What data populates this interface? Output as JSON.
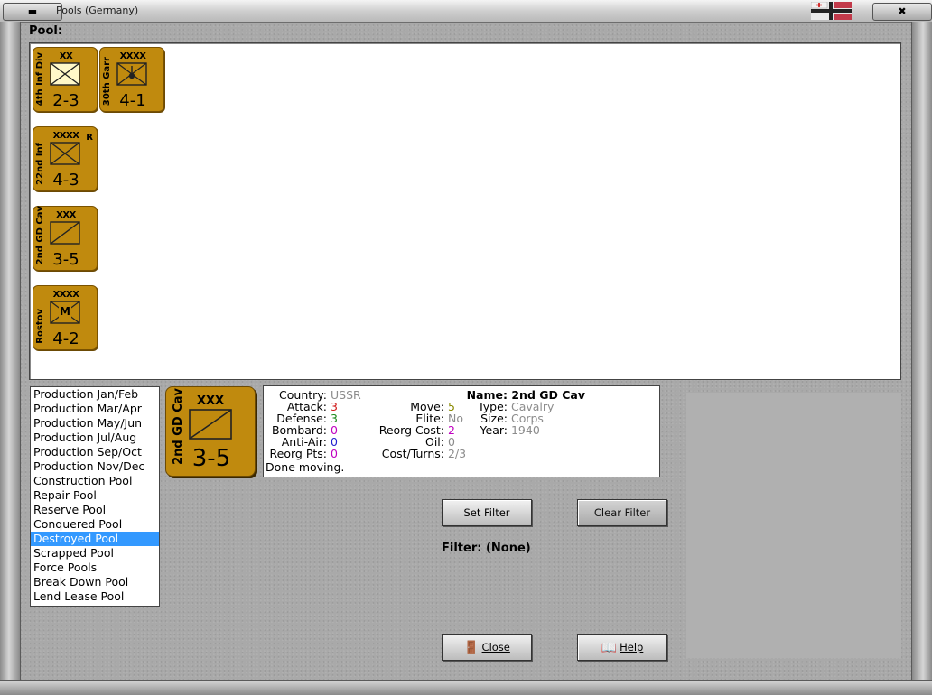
{
  "window": {
    "title": "Pools (Germany)",
    "min_label": "",
    "close_label": ""
  },
  "pool": {
    "label": "Pool:"
  },
  "counters": [
    {
      "side": "4th Inf Div",
      "size": "XX",
      "strength": "2-3",
      "corner": ""
    },
    {
      "side": "30th Garr",
      "size": "XXXX",
      "strength": "4-1",
      "corner": ""
    },
    {
      "side": "22nd Inf",
      "size": "XXXX",
      "strength": "4-3",
      "corner": "R"
    },
    {
      "side": "2nd GD Cav",
      "size": "XXX",
      "strength": "3-5",
      "corner": ""
    },
    {
      "side": "Rostov",
      "size": "XXXX",
      "strength": "4-2",
      "corner": "",
      "mark": "M"
    }
  ],
  "pool_list": {
    "items": [
      "Production Jan/Feb",
      "Production Mar/Apr",
      "Production May/Jun",
      "Production Jul/Aug",
      "Production Sep/Oct",
      "Production Nov/Dec",
      "Construction Pool",
      "Repair Pool",
      "Reserve Pool",
      "Conquered Pool",
      "Destroyed Pool",
      "Scrapped Pool",
      "Force Pools",
      "Break Down Pool",
      "Lend Lease Pool"
    ],
    "selected_index": 10
  },
  "selected_counter": {
    "side": "2nd GD Cav",
    "size": "XXX",
    "strength": "3-5"
  },
  "info": {
    "country_label": "Country:",
    "country": "USSR",
    "attack_label": "Attack:",
    "attack": "3",
    "defense_label": "Defense:",
    "defense": "3",
    "bombard_label": "Bombard:",
    "bombard": "0",
    "antiair_label": "Anti-Air:",
    "antiair": "0",
    "reorgpts_label": "Reorg Pts:",
    "reorgpts": "0",
    "status": "Done moving.",
    "move_label": "Move:",
    "move": "5",
    "elite_label": "Elite:",
    "elite": "No",
    "reorgcost_label": "Reorg Cost:",
    "reorgcost": "2",
    "oil_label": "Oil:",
    "oil": "0",
    "costturns_label": "Cost/Turns:",
    "costturns": "2/3",
    "name_label": "Name:",
    "name": "2nd GD Cav",
    "type_label": "Type:",
    "type": "Cavalry",
    "size_label": "Size:",
    "size": "Corps",
    "year_label": "Year:",
    "year": "1940"
  },
  "buttons": {
    "set_filter": "Set Filter",
    "clear_filter": "Clear Filter",
    "close": "Close",
    "help": "Help"
  },
  "filter": {
    "text": "Filter: (None)"
  },
  "colors": {
    "counter": "#c08a0e",
    "selection": "#3399ff"
  }
}
